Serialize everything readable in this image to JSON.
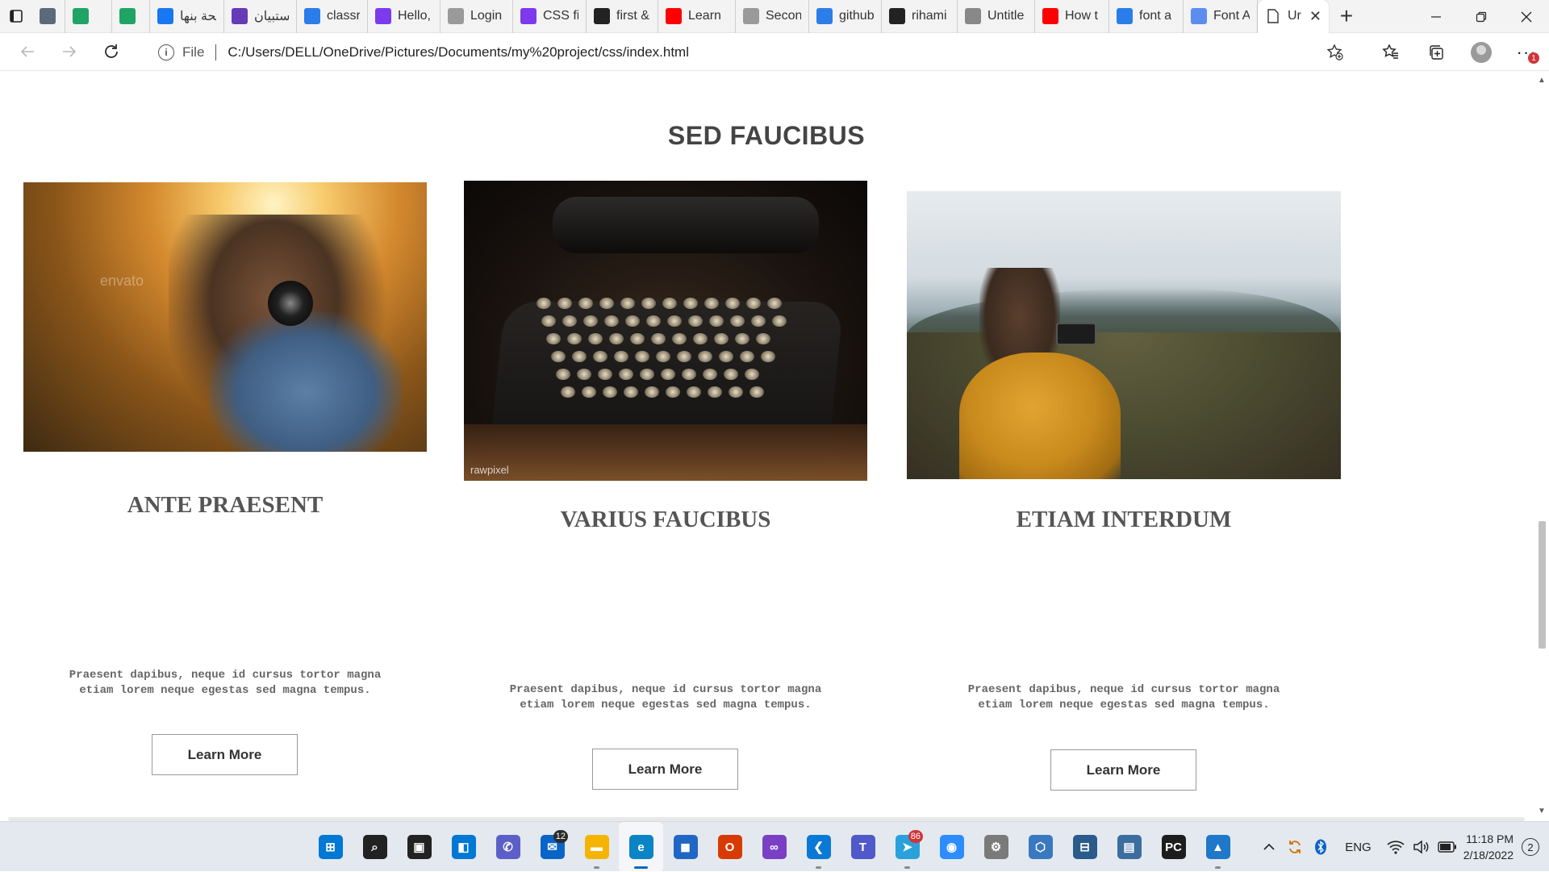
{
  "browser": {
    "tabs": [
      {
        "title": "",
        "icon": "gallery-icon",
        "color": "#5a6a7a"
      },
      {
        "title": "",
        "icon": "google-drive-icon",
        "color": "#1fa463"
      },
      {
        "title": "",
        "icon": "google-drive-icon",
        "color": "#1fa463"
      },
      {
        "title": "صفحة بنها",
        "icon": "facebook-icon",
        "color": "#1877f2"
      },
      {
        "title": "استبيان",
        "icon": "forms-icon",
        "color": "#673ab7"
      },
      {
        "title": "classro",
        "icon": "bing-icon",
        "color": "#2b7de9"
      },
      {
        "title": "Hello, ",
        "icon": "classroom-icon",
        "color": "#7c3aed"
      },
      {
        "title": "Login",
        "icon": "page-icon",
        "color": "#9a9a9a"
      },
      {
        "title": "CSS fir",
        "icon": "classroom-icon",
        "color": "#7c3aed"
      },
      {
        "title": "first &",
        "icon": "github-icon",
        "color": "#222222"
      },
      {
        "title": "Learn ",
        "icon": "youtube-icon",
        "color": "#ff0000"
      },
      {
        "title": "Secon",
        "icon": "page-icon",
        "color": "#9a9a9a"
      },
      {
        "title": "github",
        "icon": "bing-icon",
        "color": "#2b7de9"
      },
      {
        "title": "rihami",
        "icon": "github-icon",
        "color": "#222222"
      },
      {
        "title": "Untitle",
        "icon": "draw-icon",
        "color": "#888888"
      },
      {
        "title": "How t",
        "icon": "youtube-icon",
        "color": "#ff0000"
      },
      {
        "title": "font a",
        "icon": "bing-icon",
        "color": "#2b7de9"
      },
      {
        "title": "Font A",
        "icon": "flag-icon",
        "color": "#5b8def"
      }
    ],
    "active_tab": {
      "title": "Ur",
      "close": "✕"
    },
    "new_tab": "+",
    "address": {
      "protocol": "File",
      "url": "C:/Users/DELL/OneDrive/Pictures/Documents/my%20project/css/index.html"
    },
    "notification_badge": "1"
  },
  "page": {
    "section_title": "SED FAUCIBUS",
    "cards": [
      {
        "heading": "ANTE PRAESENT",
        "text_line1": "Praesent dapibus, neque id cursus tortor magna",
        "text_line2": "etiam lorem neque egestas sed magna tempus.",
        "button": "Learn More",
        "watermark": "envato"
      },
      {
        "heading": "VARIUS FAUCIBUS",
        "text_line1": "Praesent dapibus, neque id cursus tortor magna",
        "text_line2": "etiam lorem neque egestas sed magna tempus.",
        "button": "Learn More",
        "watermark": "rawpixel"
      },
      {
        "heading": "ETIAM INTERDUM",
        "text_line1": "Praesent dapibus, neque id cursus tortor magna",
        "text_line2": "etiam lorem neque egestas sed magna tempus.",
        "button": "Learn More"
      }
    ]
  },
  "taskbar": {
    "apps": [
      {
        "name": "start-icon",
        "glyph": "⊞",
        "color": "#0078d4"
      },
      {
        "name": "search-icon",
        "glyph": "⌕",
        "color": "#222222"
      },
      {
        "name": "task-view-icon",
        "glyph": "▣",
        "color": "#222222"
      },
      {
        "name": "widgets-icon",
        "glyph": "◧",
        "color": "#0078d4"
      },
      {
        "name": "chat-icon",
        "glyph": "✆",
        "color": "#5b5fc7"
      },
      {
        "name": "mail-icon",
        "glyph": "✉",
        "color": "#0a64c8",
        "badge": "12"
      },
      {
        "name": "file-explorer-icon",
        "glyph": "▬",
        "color": "#f4b400",
        "running": true
      },
      {
        "name": "edge-icon",
        "glyph": "e",
        "color": "#0b84c6",
        "running": true,
        "active": true
      },
      {
        "name": "store-icon",
        "glyph": "◼",
        "color": "#2067c4"
      },
      {
        "name": "office-icon",
        "glyph": "O",
        "color": "#d83b01"
      },
      {
        "name": "visual-studio-icon",
        "glyph": "∞",
        "color": "#7a3fc4"
      },
      {
        "name": "vscode-icon",
        "glyph": "❮",
        "color": "#0a79d6",
        "running": true
      },
      {
        "name": "teams-icon",
        "glyph": "T",
        "color": "#5059c9"
      },
      {
        "name": "telegram-icon",
        "glyph": "➤",
        "color": "#2aa1da",
        "badge": "86",
        "running": true
      },
      {
        "name": "zoom-icon",
        "glyph": "◉",
        "color": "#2d8cff"
      },
      {
        "name": "settings-app-icon",
        "glyph": "⚙",
        "color": "#7a7a7a"
      },
      {
        "name": "box-app-icon",
        "glyph": "⬡",
        "color": "#3a79c0"
      },
      {
        "name": "remote-desktop-icon",
        "glyph": "⊟",
        "color": "#2a5b8a"
      },
      {
        "name": "python-app-icon",
        "glyph": "▤",
        "color": "#3b6e9e"
      },
      {
        "name": "pycharm-icon",
        "glyph": "PC",
        "color": "#1d1d1d"
      },
      {
        "name": "photos-icon",
        "glyph": "▲",
        "color": "#1f78c8",
        "running": true
      }
    ],
    "tray": {
      "language": "ENG",
      "time": "11:18 PM",
      "date": "2/18/2022",
      "notifications": "2"
    }
  }
}
